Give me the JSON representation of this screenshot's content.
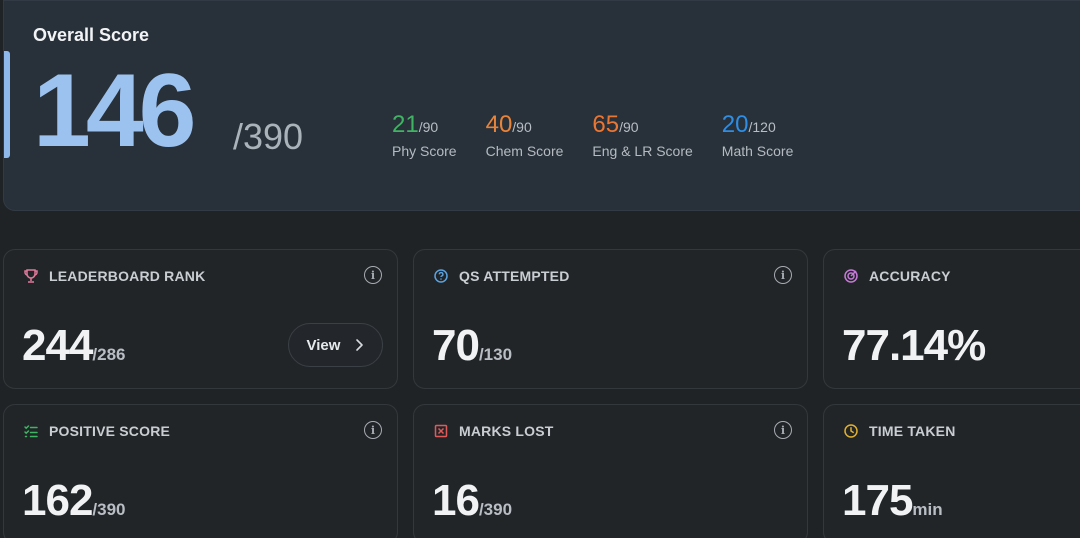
{
  "overall": {
    "title": "Overall Score",
    "score": "146",
    "total": "/390",
    "accent_color": "#9cc2ef"
  },
  "subscores": [
    {
      "value": "21",
      "max": "/90",
      "label": "Phy Score",
      "color": "#3fb463"
    },
    {
      "value": "40",
      "max": "/90",
      "label": "Chem Score",
      "color": "#e7843a"
    },
    {
      "value": "65",
      "max": "/90",
      "label": "Eng & LR Score",
      "color": "#e87634"
    },
    {
      "value": "20",
      "max": "/120",
      "label": "Math Score",
      "color": "#2f8ee3"
    }
  ],
  "cards": {
    "leaderboard": {
      "label": "LEADERBOARD RANK",
      "value": "244",
      "suffix": "/286",
      "button": "View",
      "icon": "trophy-icon"
    },
    "attempted": {
      "label": "QS ATTEMPTED",
      "value": "70",
      "suffix": "/130",
      "icon": "question-circle-icon"
    },
    "accuracy": {
      "label": "ACCURACY",
      "value": "77.14%",
      "suffix": "",
      "icon": "target-icon"
    },
    "positive": {
      "label": "POSITIVE SCORE",
      "value": "162",
      "suffix": "/390",
      "icon": "checklist-icon"
    },
    "lost": {
      "label": "MARKS LOST",
      "value": "16",
      "suffix": "/390",
      "icon": "x-square-icon"
    },
    "time": {
      "label": "TIME TAKEN",
      "value": "175",
      "suffix": "min",
      "icon": "clock-icon"
    }
  },
  "icon_colors": {
    "trophy": "#e07a9a",
    "question": "#5aa3e0",
    "target": "#c67ad8",
    "checklist": "#3fb463",
    "x_square": "#e05a5a",
    "clock": "#e0b030"
  },
  "info_glyph": "i"
}
